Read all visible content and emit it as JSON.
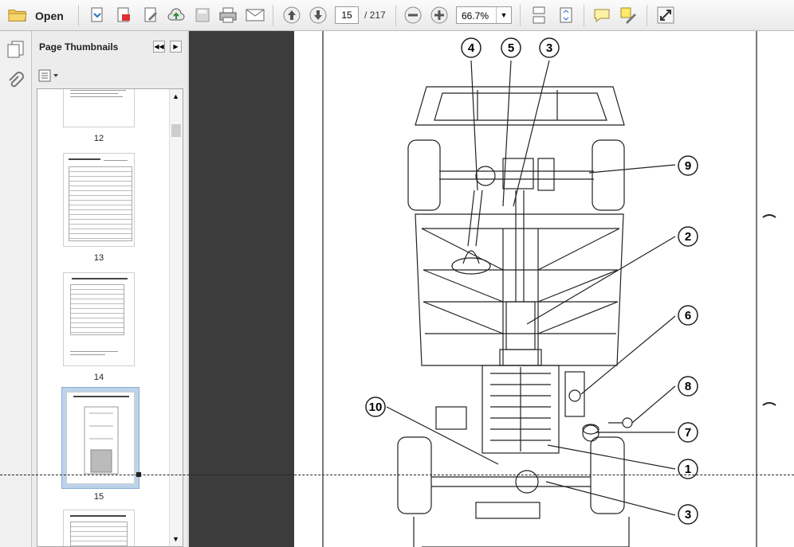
{
  "toolbar": {
    "open_label": "Open",
    "page_current": "15",
    "page_total": "/ 217",
    "zoom": "66.7%"
  },
  "panel": {
    "title": "Page Thumbnails",
    "thumbnails": [
      {
        "label": "12"
      },
      {
        "label": "13"
      },
      {
        "label": "14"
      },
      {
        "label": "15"
      }
    ]
  },
  "diagram": {
    "callouts": [
      "4",
      "5",
      "3",
      "9",
      "2",
      "6",
      "8",
      "7",
      "10",
      "1",
      "3"
    ]
  },
  "colors": {
    "workspace_gray": "#3c3c3c",
    "thumb_selection": "#bcd3ea"
  }
}
